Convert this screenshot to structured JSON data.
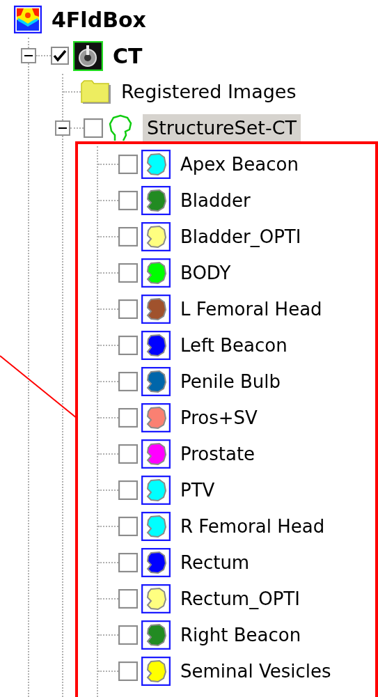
{
  "tree": {
    "label": "4FldBox",
    "children": [
      {
        "kind": "series",
        "label": "CT",
        "checked": true,
        "expanded": true,
        "children": [
          {
            "kind": "folder",
            "label": "Registered Images"
          },
          {
            "kind": "structure_set",
            "label": "StructureSet-CT",
            "checked": false,
            "expanded": true,
            "selected": true,
            "children": [
              {
                "kind": "structure",
                "label": "Apex Beacon",
                "checked": false,
                "color": "#00ffff"
              },
              {
                "kind": "structure",
                "label": "Bladder",
                "checked": false,
                "color": "#228b22"
              },
              {
                "kind": "structure",
                "label": "Bladder_OPTI",
                "checked": false,
                "color": "#ffff80"
              },
              {
                "kind": "structure",
                "label": "BODY",
                "checked": false,
                "color": "#00ff00"
              },
              {
                "kind": "structure",
                "label": "L Femoral Head",
                "checked": false,
                "color": "#a0522d"
              },
              {
                "kind": "structure",
                "label": "Left Beacon",
                "checked": false,
                "color": "#0000ff"
              },
              {
                "kind": "structure",
                "label": "Penile Bulb",
                "checked": false,
                "color": "#0066aa"
              },
              {
                "kind": "structure",
                "label": "Pros+SV",
                "checked": false,
                "color": "#fa8072"
              },
              {
                "kind": "structure",
                "label": "Prostate",
                "checked": false,
                "color": "#ff00ff"
              },
              {
                "kind": "structure",
                "label": "PTV",
                "checked": false,
                "color": "#00ffff"
              },
              {
                "kind": "structure",
                "label": "R Femoral Head",
                "checked": false,
                "color": "#00ffff"
              },
              {
                "kind": "structure",
                "label": "Rectum",
                "checked": false,
                "color": "#0000ff"
              },
              {
                "kind": "structure",
                "label": "Rectum_OPTI",
                "checked": false,
                "color": "#ffff80"
              },
              {
                "kind": "structure",
                "label": "Right Beacon",
                "checked": false,
                "color": "#228b22"
              },
              {
                "kind": "structure",
                "label": "Seminal Vesicles",
                "checked": false,
                "color": "#ffff00"
              }
            ]
          }
        ]
      }
    ]
  }
}
